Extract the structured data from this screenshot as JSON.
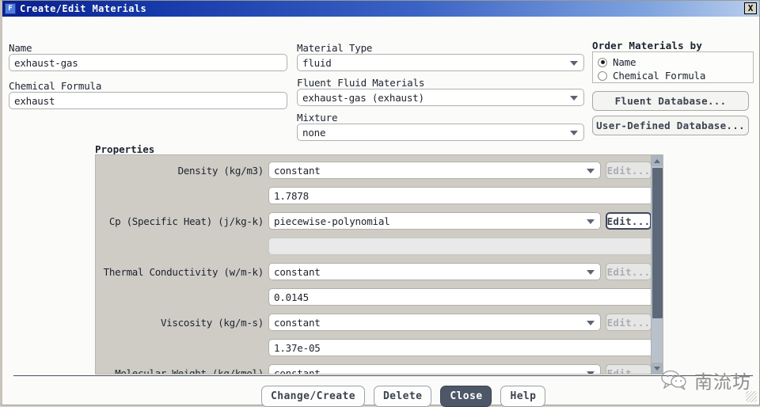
{
  "window": {
    "title": "Create/Edit Materials",
    "icon": "fluent-app-icon",
    "icon_letter": "F",
    "close_label": "X"
  },
  "left": {
    "name_label": "Name",
    "name_value": "exhaust-gas",
    "formula_label": "Chemical Formula",
    "formula_value": "exhaust"
  },
  "middle": {
    "material_type_label": "Material Type",
    "material_type_value": "fluid",
    "fluent_materials_label": "Fluent Fluid Materials",
    "fluent_materials_value": "exhaust-gas (exhaust)",
    "mixture_label": "Mixture",
    "mixture_value": "none"
  },
  "right": {
    "order_by_label": "Order Materials by",
    "options": [
      {
        "label": "Name",
        "selected": true
      },
      {
        "label": "Chemical Formula",
        "selected": false
      }
    ],
    "fluent_db_button": "Fluent Database...",
    "user_db_button": "User-Defined Database..."
  },
  "properties": {
    "title": "Properties",
    "edit_label": "Edit...",
    "rows": [
      {
        "label": "Density (kg/m3)",
        "method": "constant",
        "value": "1.7878",
        "edit_active": false,
        "value_disabled": false
      },
      {
        "label": "Cp (Specific Heat) (j/kg-k)",
        "method": "piecewise-polynomial",
        "value": "",
        "edit_active": true,
        "value_disabled": true
      },
      {
        "label": "Thermal Conductivity (w/m-k)",
        "method": "constant",
        "value": "0.0145",
        "edit_active": false,
        "value_disabled": false
      },
      {
        "label": "Viscosity (kg/m-s)",
        "method": "constant",
        "value": "1.37e-05",
        "edit_active": false,
        "value_disabled": false
      },
      {
        "label": "Molecular Weight (kg/kmol)",
        "method": "constant",
        "value": "",
        "edit_active": false,
        "value_disabled": false
      }
    ]
  },
  "footer": {
    "buttons": [
      {
        "label": "Change/Create",
        "primary": false
      },
      {
        "label": "Delete",
        "primary": false
      },
      {
        "label": "Close",
        "primary": true
      },
      {
        "label": "Help",
        "primary": false
      }
    ]
  },
  "watermark": {
    "icon": "wechat-bubbles-icon",
    "text": "南流坊"
  }
}
